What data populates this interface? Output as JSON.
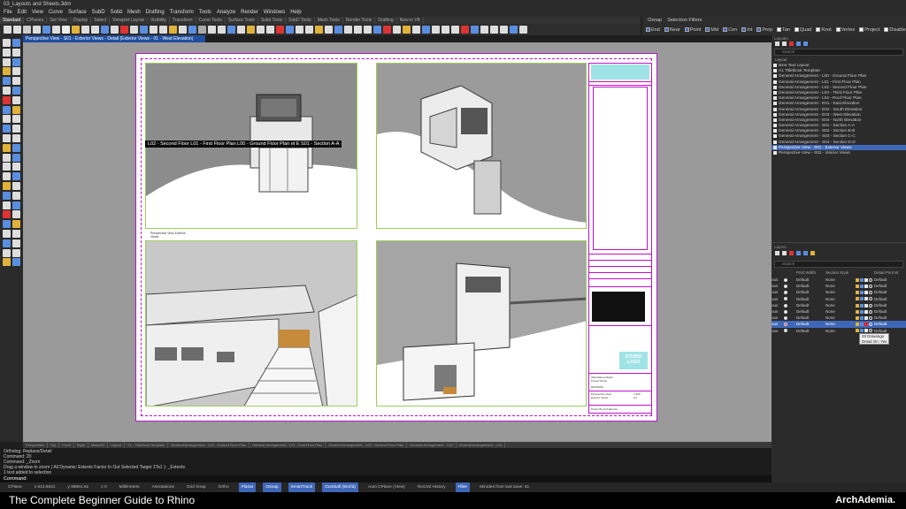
{
  "window": {
    "title": "03_Layouts and Sheets.3dm"
  },
  "menu": [
    "File",
    "Edit",
    "View",
    "Curve",
    "Surface",
    "SubD",
    "Solid",
    "Mesh",
    "Drafting",
    "Transform",
    "Tools",
    "Analyze",
    "Render",
    "Windows",
    "Help"
  ],
  "toolbar_tabs": [
    "Standard",
    "CPlanes",
    "Set View",
    "Display",
    "Select",
    "Viewport Layout",
    "Visibility",
    "Transform",
    "Curve Tools",
    "Surface Tools",
    "Solid Tools",
    "SubD Tools",
    "Mesh Tools",
    "Render Tools",
    "Drafting",
    "New in V8"
  ],
  "osnap": {
    "tabs": [
      "Osnap",
      "Selection Filters"
    ],
    "items": [
      {
        "label": "End",
        "checked": true
      },
      {
        "label": "Near",
        "checked": true
      },
      {
        "label": "Point",
        "checked": true
      },
      {
        "label": "Mid",
        "checked": true
      },
      {
        "label": "Cen",
        "checked": true
      },
      {
        "label": "Int",
        "checked": true
      },
      {
        "label": "Perp",
        "checked": true
      },
      {
        "label": "Tan",
        "checked": false
      },
      {
        "label": "Quad",
        "checked": false
      },
      {
        "label": "Knot",
        "checked": false
      },
      {
        "label": "Vertex",
        "checked": false
      },
      {
        "label": "Project",
        "checked": false
      },
      {
        "label": "Disable",
        "checked": false
      }
    ]
  },
  "viewport": {
    "title": "Perspective View - S01 - Exterior Views - Detail (Exterior Views - 01 - West Elevation)",
    "layout_names_bar": "L02 - Second Floor  L01 - First Floor Plan  L00 - Ground Floor Plan  et E  S01 - Section A-A",
    "detail_note": "Perspective View\nExterior Views"
  },
  "titleblock": {
    "studio_logo": "STUDIO\nLOGO",
    "project_name": "Villa Mairea Model\nProject Name",
    "date_label": "DRAWING",
    "subtitle": "Perspective View\nExterior Views",
    "sheet_no": "1:200\nA3",
    "drawn_by": "Drawn By Archademia"
  },
  "sheet_tabs": [
    "Perspective",
    "Top",
    "Front",
    "Right",
    "Make2D",
    "Layout",
    "S1 - Titleblock Template",
    "General Arrangement - L00 - Ground Floor Plan",
    "General Arrangement - L01 - First Floor Plan",
    "General Arrangement - L02 - Second Floor Plan",
    "General Arrangement - L03",
    "General Arrangement - L04"
  ],
  "command_history": [
    "Ortholog: Replace/Detail",
    "Command: 20",
    "Command: _Zoom",
    "Drag a window to zoom ( All  Dynamic  Extents  Factor  In  Out  Selected  Target  1To1 ): _Extents",
    "1 text added to selection"
  ],
  "command_prompt": "Command:",
  "statusbar": {
    "items": [
      "CPlane",
      "x 513.6641",
      "y 88691.61",
      "z 0",
      "Millimeters",
      "Annotations",
      "Grid Snap",
      "Ortho",
      "Planar",
      "Osnap",
      "SmartTrack",
      "Gumball (World)",
      "Auto CPlane (View)",
      "Record History",
      "Filter",
      "Minutes from last save: 61"
    ],
    "active": [
      "Planar",
      "Osnap",
      "SmartTrack",
      "Gumball (World)",
      "Filter"
    ]
  },
  "caption": "The Complete Beginner Guide to Rhino",
  "brand": "ArchAdemia.",
  "layouts_panel": {
    "header": "Layouts",
    "search_placeholder": "Search",
    "group": "Layout",
    "items": [
      "New Text Layout",
      "A1 Titleblock Template",
      "General Arrangement - L00 - Ground Floor Plan",
      "General Arrangement - L01 - First Floor Plan",
      "General Arrangement - L02 - Second Floor Plan",
      "General Arrangement - L03 - Third Floor Plan",
      "General Arrangement - L04 - Roof Floor Plan",
      "General Arrangement - E01 - East Elevation",
      "General Arrangement - E02 - South Elevation",
      "General Arrangement - E03 - West Elevation",
      "General Arrangement - E04 - North Elevation",
      "General Arrangement - S01 - Section A-A",
      "General Arrangement - S02 - Section B-B",
      "General Arrangement - S03 - Section C-C",
      "General Arrangement - S04 - Section D-D",
      "Perspective View - S01 - Exterior Views",
      "Perspective View - S02 - Interior Views"
    ],
    "selected_index": 15
  },
  "layers_panel": {
    "header": "Layers",
    "search_placeholder": "Search",
    "columns": [
      "Print Width",
      "Section Style",
      "Detail Print W"
    ],
    "rows": [
      {
        "name": "ous",
        "print_width": "Default",
        "section": "None",
        "detail": "Default",
        "color": "#e8e8e8"
      },
      {
        "name": "ous",
        "print_width": "Default",
        "section": "None",
        "detail": "Default",
        "color": "#e8e8e8"
      },
      {
        "name": "ous",
        "print_width": "Default",
        "section": "None",
        "detail": "Default",
        "color": "#e8e8e8"
      },
      {
        "name": "ous",
        "print_width": "Default",
        "section": "None",
        "detail": "Default",
        "color": "#e8e8e8"
      },
      {
        "name": "ous",
        "print_width": "Default",
        "section": "None",
        "detail": "Default",
        "color": "#e8e8e8"
      },
      {
        "name": "ous",
        "print_width": "Default",
        "section": "None",
        "detail": "Default",
        "color": "#e8e8e8"
      },
      {
        "name": "ous",
        "print_width": "Default",
        "section": "None",
        "detail": "Default",
        "color": "#e8e8e8"
      },
      {
        "name": "ous",
        "print_width": "Default",
        "section": "None",
        "detail": "Default",
        "color": "#ff2020"
      },
      {
        "name": "ous",
        "print_width": "Default",
        "section": "None",
        "detail": "Default",
        "color": "#e8e8e8"
      }
    ],
    "selected_index": 7,
    "tooltip": "03 Drawings\nDetail On: Yes"
  },
  "colors": {
    "accent": "#3f67b8",
    "sheet_border": "#c010c8",
    "detail_frame": "#9ccd5a",
    "studio": "#9fe3e6"
  }
}
